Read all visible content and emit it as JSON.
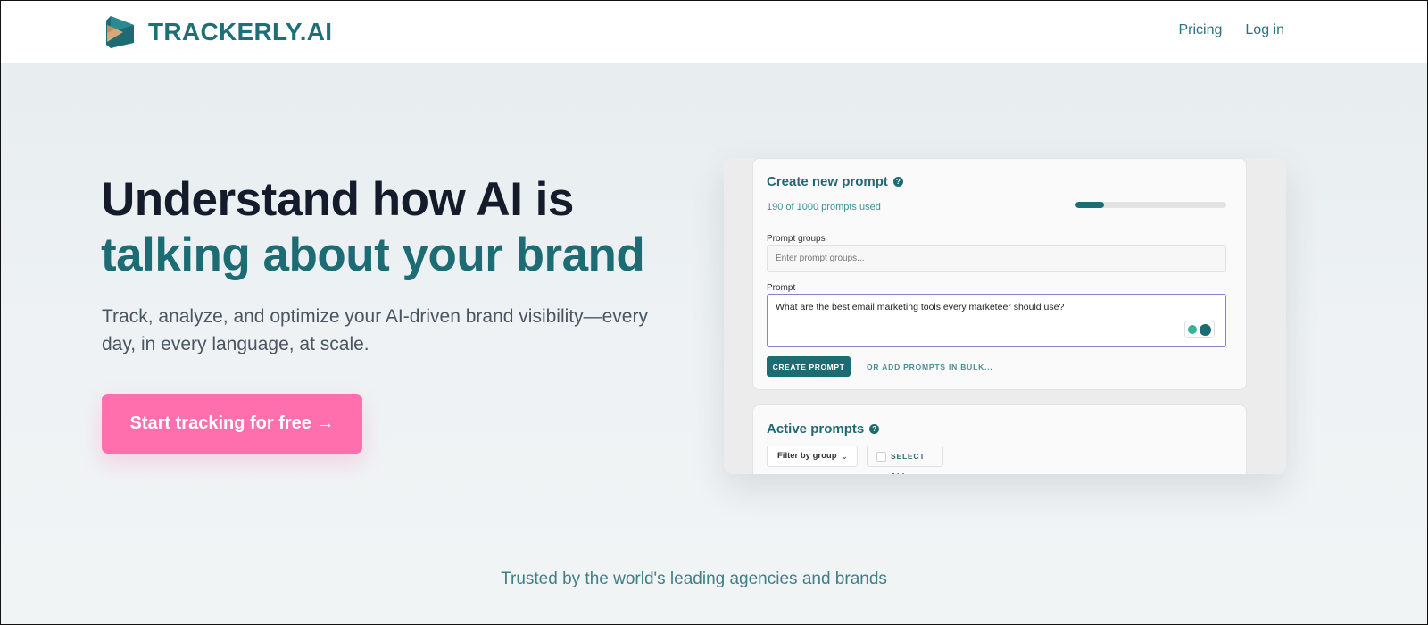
{
  "header": {
    "brand": "TRACKERLY.AI",
    "logo_icon": "trackerly-logo-icon",
    "nav": [
      {
        "label": "Pricing"
      },
      {
        "label": "Log in"
      }
    ]
  },
  "hero": {
    "title_line1": "Understand how AI is",
    "title_line2": "talking about your brand",
    "subtitle": "Track, analyze, and optimize your AI-driven brand visibility—every day, in every language, at scale.",
    "cta_label": "Start tracking for free →"
  },
  "mockup": {
    "create": {
      "title": "Create new prompt",
      "usage_text": "190 of 1000 prompts used",
      "usage_fraction": 0.19,
      "groups_label": "Prompt groups",
      "groups_placeholder": "Enter prompt groups...",
      "prompt_label": "Prompt",
      "prompt_value": "What are the best email marketing tools every marketeer should use?",
      "create_button": "CREATE PROMPT",
      "bulk_link": "OR ADD PROMPTS IN BULK..."
    },
    "active": {
      "title": "Active prompts",
      "filter_label": "Filter by group",
      "select_all_label": "SELECT ALL"
    }
  },
  "footer": {
    "trusted_text": "Trusted by the world's leading agencies and brands"
  },
  "colors": {
    "brand_teal": "#1d6c73",
    "cta_pink": "#ff6fae",
    "heading_dark": "#141c2b"
  }
}
